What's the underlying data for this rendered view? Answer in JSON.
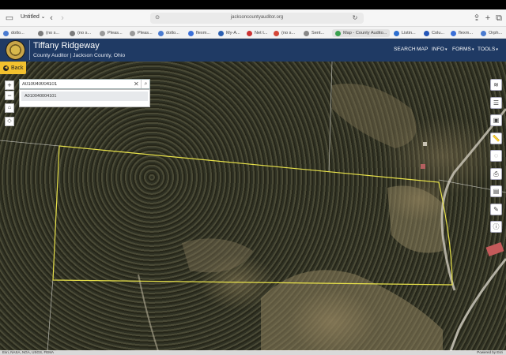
{
  "browser": {
    "window_title": "Untitled",
    "url": "jacksoncountyauditor.org"
  },
  "favorites": [
    {
      "label": "dotlo...",
      "color": "#4a7bd0"
    },
    {
      "label": "(no s...",
      "color": "#7a7a7a"
    },
    {
      "label": "(no s...",
      "color": "#7a7a7a"
    },
    {
      "label": "Pleas...",
      "color": "#999999"
    },
    {
      "label": "Pleas...",
      "color": "#999999"
    },
    {
      "label": "dotlo...",
      "color": "#4a7bd0"
    },
    {
      "label": "flexm...",
      "color": "#3a6fd8"
    },
    {
      "label": "My-A...",
      "color": "#2b5fb0"
    },
    {
      "label": "Net t...",
      "color": "#cc3333"
    },
    {
      "label": "(no s...",
      "color": "#d44638"
    },
    {
      "label": "Sent...",
      "color": "#888888"
    },
    {
      "label": "Map - County Audito...",
      "color": "#3aa14f"
    },
    {
      "label": "Listin...",
      "color": "#2d6fd0"
    },
    {
      "label": "Colu...",
      "color": "#2456b8"
    },
    {
      "label": "flexm...",
      "color": "#3a6fd8"
    },
    {
      "label": "Orph...",
      "color": "#4a7bd0"
    }
  ],
  "header": {
    "title": "Tiffany Ridgeway",
    "subtitle": "County Auditor | Jackson County, Ohio",
    "nav": [
      {
        "label": "SEARCH",
        "dropdown": false
      },
      {
        "label": "MAP",
        "dropdown": false
      },
      {
        "label": "INFO",
        "dropdown": true
      },
      {
        "label": "FORMS",
        "dropdown": true
      },
      {
        "label": "TOOLS",
        "dropdown": true
      }
    ]
  },
  "map": {
    "back_label": "Back",
    "search_value": "A010040004101",
    "suggestion": "A010040004101",
    "right_tools": [
      "layers-icon",
      "list-icon",
      "identify-icon",
      "measure-icon",
      "hide-icon",
      "print-icon",
      "save-icon",
      "comment-icon",
      "info-icon"
    ],
    "attribution_left": "Esri, NASA, NGA, USGS, FEMA",
    "attribution_right": "Powered by Esri",
    "parcel_line_color": "#e8e24a"
  }
}
